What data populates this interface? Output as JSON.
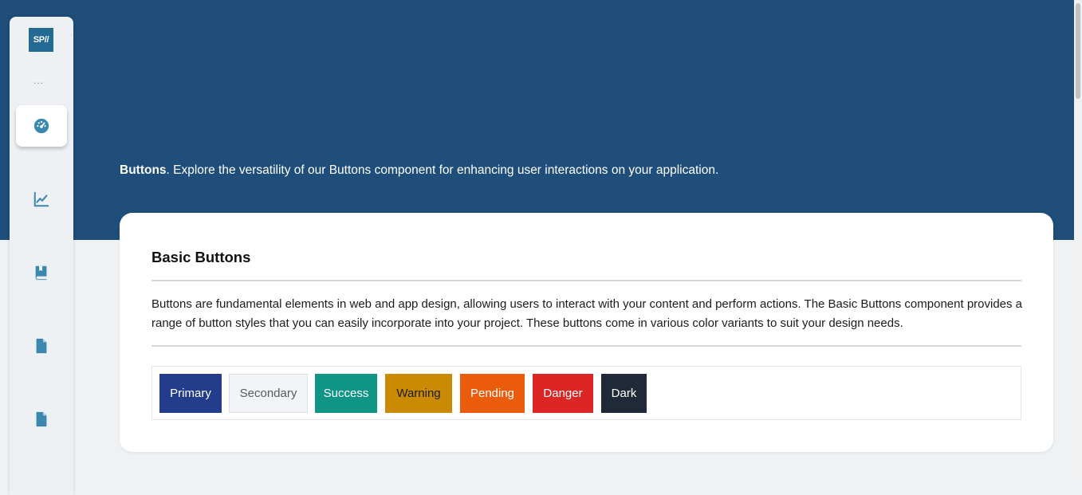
{
  "sidebar": {
    "logo_text": "SP//",
    "more_text": "...",
    "items": [
      {
        "icon": "dashboard-gauge-icon",
        "active": true
      },
      {
        "icon": "line-chart-icon",
        "active": false
      },
      {
        "icon": "book-icon",
        "active": false
      },
      {
        "icon": "document-icon",
        "active": false
      },
      {
        "icon": "document-icon",
        "active": false
      }
    ]
  },
  "hero": {
    "intro_bold": "Buttons",
    "intro_text": ". Explore the versatility of our Buttons component for enhancing user interactions on your application."
  },
  "card": {
    "title": "Basic Buttons",
    "description": "Buttons are fundamental elements in web and app design, allowing users to interact with your content and perform actions. The Basic Buttons component provides a range of button styles that you can easily incorporate into your project. These buttons come in various color variants to suit your design needs.",
    "buttons": [
      {
        "label": "Primary",
        "bg": "#233c8c",
        "color": "#ffffff"
      },
      {
        "label": "Secondary",
        "bg": "#f3f4f6",
        "color": "#555b63"
      },
      {
        "label": "Success",
        "bg": "#0f9486",
        "color": "#ffffff"
      },
      {
        "label": "Warning",
        "bg": "#ca8a04",
        "color": "#1b1b1b"
      },
      {
        "label": "Pending",
        "bg": "#ea5c0c",
        "color": "#ffffff"
      },
      {
        "label": "Danger",
        "bg": "#dc2626",
        "color": "#ffffff"
      },
      {
        "label": "Dark",
        "bg": "#1f2937",
        "color": "#ffffff"
      }
    ]
  },
  "colors": {
    "hero_bg": "#1e4e79",
    "page_bg": "#eff2f5",
    "icon_accent": "#3a88b0"
  }
}
